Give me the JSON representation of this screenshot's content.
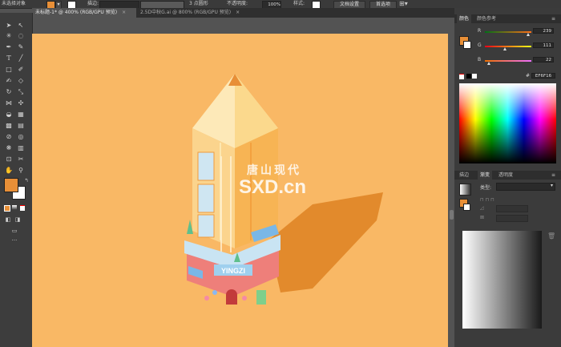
{
  "control_bar": {
    "selection_label": "未选择对象",
    "stroke_label": "描边:",
    "point_value": "3 点圆形",
    "opacity_label": "不透明度:",
    "opacity_value": "100%",
    "style_label": "样式:",
    "doc_setup_button": "文档设置",
    "preferences_button": "首选项",
    "fill_color": "#e88f37"
  },
  "tabs": [
    {
      "label": "未标题-1* @ 400% (RGB/GPU 预览)",
      "close": "×"
    },
    {
      "label": "2.5D中秋G.ai @ 800% (RGB/GPU 预览)",
      "close": "×"
    }
  ],
  "watermark": {
    "chinese": "唐山现代",
    "latin": "SXD.cn"
  },
  "illustration": {
    "sign_text": "YINGZI",
    "background_color": "#f9b865"
  },
  "color_panel": {
    "tabs": [
      "颜色",
      "颜色参考"
    ],
    "channels": [
      {
        "name": "R",
        "value": "239",
        "fraction": 0.937
      },
      {
        "name": "G",
        "value": "111",
        "fraction": 0.435
      },
      {
        "name": "B",
        "value": "22",
        "fraction": 0.086
      }
    ],
    "hex_label": "#",
    "hex_value": "EF6F16",
    "swatch_color": "#e88f37"
  },
  "gradient_panel": {
    "tabs": [
      "描边",
      "渐变",
      "透明度"
    ],
    "type_label": "类型:"
  }
}
